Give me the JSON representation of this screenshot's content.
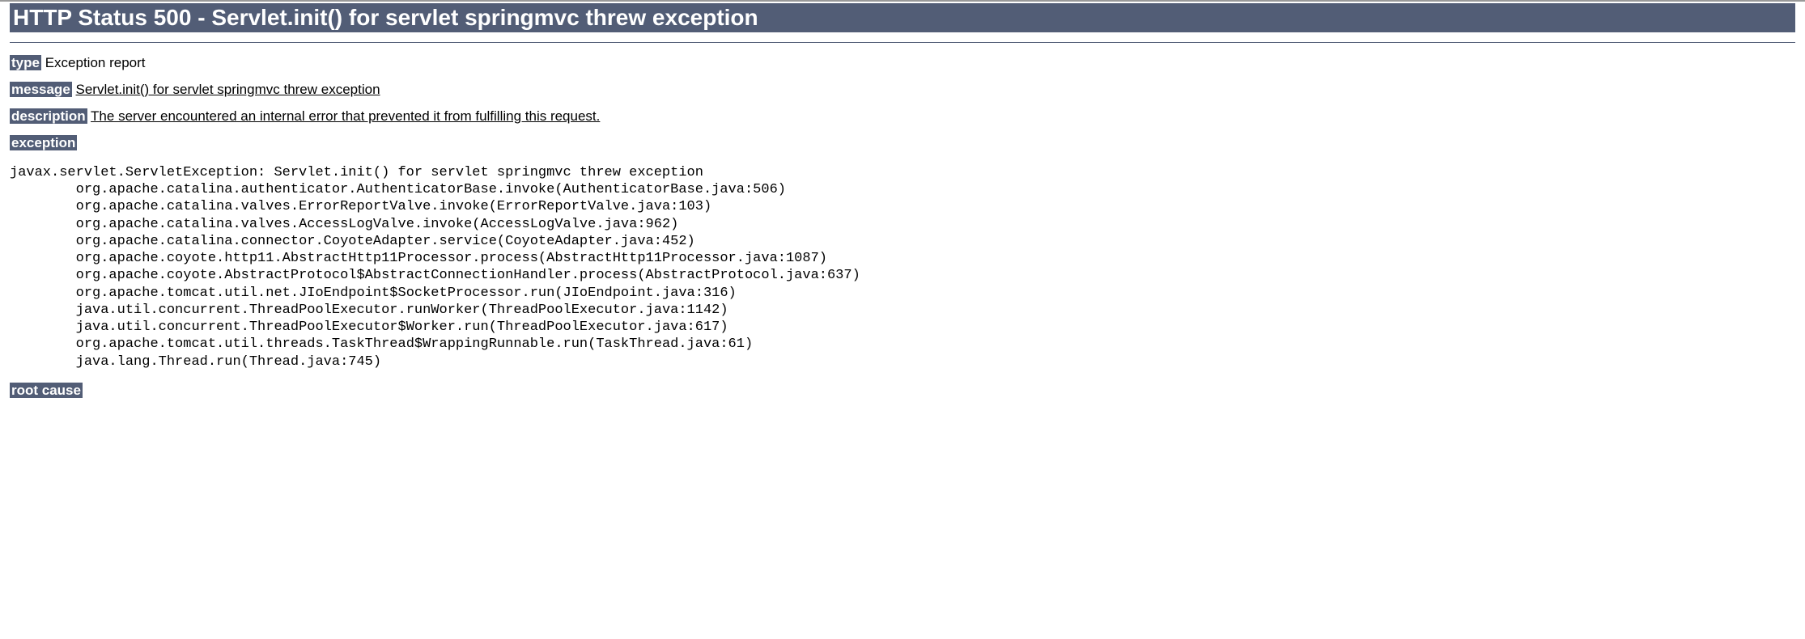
{
  "header": {
    "title": "HTTP Status 500 - Servlet.init() for servlet springmvc threw exception"
  },
  "type": {
    "label": "type",
    "value": "Exception report"
  },
  "message": {
    "label": "message",
    "value": "Servlet.init() for servlet springmvc threw exception"
  },
  "description": {
    "label": "description",
    "value": "The server encountered an internal error that prevented it from fulfilling this request."
  },
  "exception": {
    "label": "exception",
    "stacktrace": "javax.servlet.ServletException: Servlet.init() for servlet springmvc threw exception\n\torg.apache.catalina.authenticator.AuthenticatorBase.invoke(AuthenticatorBase.java:506)\n\torg.apache.catalina.valves.ErrorReportValve.invoke(ErrorReportValve.java:103)\n\torg.apache.catalina.valves.AccessLogValve.invoke(AccessLogValve.java:962)\n\torg.apache.catalina.connector.CoyoteAdapter.service(CoyoteAdapter.java:452)\n\torg.apache.coyote.http11.AbstractHttp11Processor.process(AbstractHttp11Processor.java:1087)\n\torg.apache.coyote.AbstractProtocol$AbstractConnectionHandler.process(AbstractProtocol.java:637)\n\torg.apache.tomcat.util.net.JIoEndpoint$SocketProcessor.run(JIoEndpoint.java:316)\n\tjava.util.concurrent.ThreadPoolExecutor.runWorker(ThreadPoolExecutor.java:1142)\n\tjava.util.concurrent.ThreadPoolExecutor$Worker.run(ThreadPoolExecutor.java:617)\n\torg.apache.tomcat.util.threads.TaskThread$WrappingRunnable.run(TaskThread.java:61)\n\tjava.lang.Thread.run(Thread.java:745)"
  },
  "root_cause": {
    "label": "root cause"
  }
}
